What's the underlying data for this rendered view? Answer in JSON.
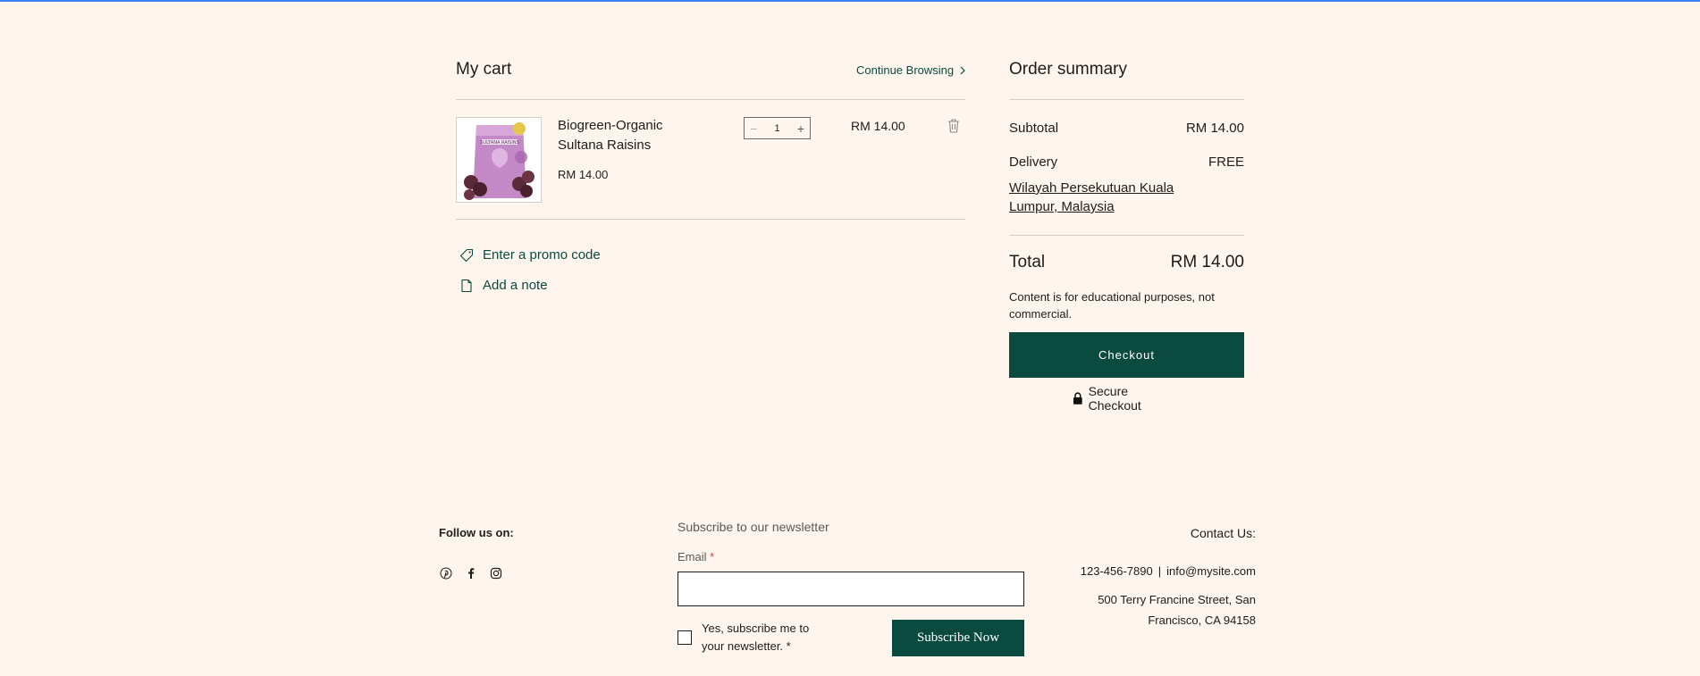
{
  "cart": {
    "title": "My cart",
    "continue_label": "Continue Browsing",
    "item": {
      "name": "Biogreen-Organic Sultana Raisins",
      "price": "RM 14.00",
      "quantity": "1",
      "line_total": "RM 14.00",
      "image_label": "SULTANA RAISINS"
    },
    "promo_label": "Enter a promo code",
    "note_label": "Add a note"
  },
  "summary": {
    "title": "Order summary",
    "subtotal_label": "Subtotal",
    "subtotal_value": "RM 14.00",
    "delivery_label": "Delivery",
    "delivery_value": "FREE",
    "location": "Wilayah Persekutuan Kuala Lumpur, Malaysia",
    "total_label": "Total",
    "total_value": "RM 14.00",
    "disclaimer": "Content is for educational purposes, not commercial.",
    "checkout_label": "Checkout",
    "secure_label": "Secure Checkout"
  },
  "footer": {
    "follow_label": "Follow us on:",
    "socials": [
      "pinterest-icon",
      "facebook-icon",
      "instagram-icon"
    ],
    "newsletter_title": "Subscribe to our newsletter",
    "email_label": "Email",
    "email_required": "*",
    "email_value": "",
    "consent_text": "Yes, subscribe me to your newsletter.",
    "consent_required": "*",
    "subscribe_label": "Subscribe Now",
    "contact_title": "Contact Us:",
    "phone": "123-456-7890",
    "separator": "|",
    "email": "info@mysite.com",
    "address": "500 Terry Francine Street, San Francisco, CA 94158"
  },
  "colors": {
    "background": "#fdf5ee",
    "accent": "#0b4a3e",
    "divider": "#d9cdc2"
  }
}
